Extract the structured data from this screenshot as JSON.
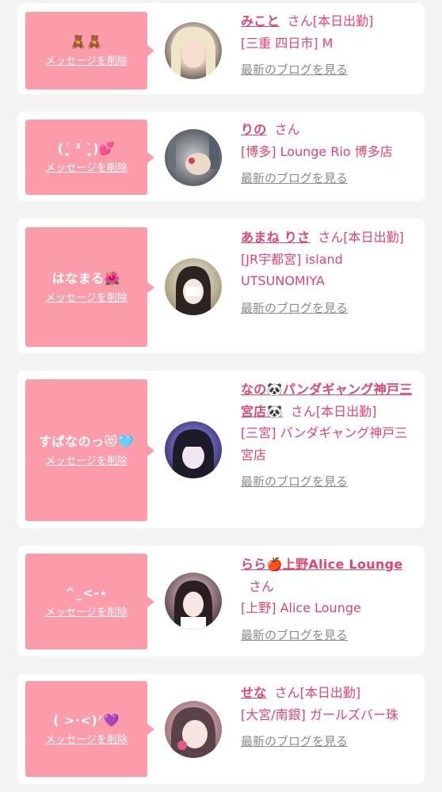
{
  "labels": {
    "delete_message": "メッセージを削除",
    "view_blog": "最新のブログを見る",
    "san": "さん"
  },
  "items": [
    {
      "message": "🧸🧸",
      "name": "みこと",
      "status": "[本日出勤]",
      "shop": "[三重 四日市] M"
    },
    {
      "message": "(ˊ̥̥̥̥̥ ³ ˋ̥̥̥̥̥)💕",
      "name": "りの",
      "status": "",
      "shop": "[博多] Lounge Rio 博多店"
    },
    {
      "message": "はなまる🌺",
      "name": "あまね りさ",
      "status": "[本日出勤]",
      "shop": "[JR宇都宮] island UTSUNOMIYA"
    },
    {
      "message": "すぱなのっ😻🩵",
      "name": "なの🐼パンダギャング神戸三宮店🐼",
      "status": "[本日出勤]",
      "shop": "[三宮] パンダギャング神戸三宮店"
    },
    {
      "message": "^_<-⋆",
      "name": "らら🍎上野Alice Lounge",
      "status": "",
      "shop": "[上野] Alice Lounge"
    },
    {
      "message": "( >·<)ᐟ💜",
      "name": "せな",
      "status": "[本日出勤]",
      "shop": "[大宮/南銀] ガールズバー珠"
    }
  ]
}
